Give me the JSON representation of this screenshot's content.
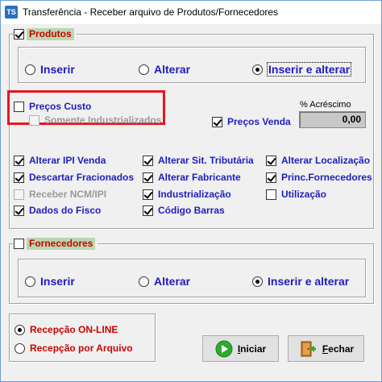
{
  "window": {
    "title": "Transferência - Receber arquivo de Produtos/Fornecedores",
    "icon": "ts-app-icon",
    "icon_text": "TS"
  },
  "produtos": {
    "legend": "Produtos",
    "checked": true,
    "options": [
      {
        "label": "Inserir",
        "selected": false
      },
      {
        "label": "Alterar",
        "selected": false
      },
      {
        "label": "Inserir e alterar",
        "selected": true
      }
    ],
    "precos_custo": {
      "label": "Preços Custo",
      "checked": false
    },
    "somente_industrializados": {
      "label": "Somente Industrializados",
      "checked": false,
      "disabled": true
    },
    "acrescimo_label": "% Acréscimo",
    "precos_venda": {
      "label": "Preços Venda",
      "checked": true
    },
    "acrescimo_value": "0,00",
    "flags": [
      {
        "label": "Alterar IPI Venda",
        "checked": true,
        "disabled": false
      },
      {
        "label": "Alterar Sit. Tributária",
        "checked": true,
        "disabled": false
      },
      {
        "label": "Alterar Localização",
        "checked": true,
        "disabled": false
      },
      {
        "label": "Descartar Fracionados",
        "checked": true,
        "disabled": false
      },
      {
        "label": "Alterar Fabricante",
        "checked": true,
        "disabled": false
      },
      {
        "label": "Princ.Fornecedores",
        "checked": true,
        "disabled": false
      },
      {
        "label": "Receber NCM/IPI",
        "checked": false,
        "disabled": true
      },
      {
        "label": "Industrialização",
        "checked": true,
        "disabled": false
      },
      {
        "label": "Utilização",
        "checked": false,
        "disabled": false
      },
      {
        "label": "Dados do Fisco",
        "checked": true,
        "disabled": false
      },
      {
        "label": "Código Barras",
        "checked": true,
        "disabled": false
      }
    ]
  },
  "fornecedores": {
    "legend": "Fornecedores",
    "checked": false,
    "options": [
      {
        "label": "Inserir",
        "selected": false
      },
      {
        "label": "Alterar",
        "selected": false
      },
      {
        "label": "Inserir e alterar",
        "selected": true
      }
    ]
  },
  "recepcao": {
    "online": {
      "label": "Recepção ON-LINE",
      "selected": true
    },
    "arquivo": {
      "label": "Recepção por Arquivo",
      "selected": false
    }
  },
  "buttons": {
    "iniciar": {
      "accel": "I",
      "rest": "niciar"
    },
    "fechar": {
      "accel": "F",
      "rest": "echar"
    }
  },
  "colors": {
    "highlight": "#e8151f",
    "label_blue": "#1e1ebe",
    "label_red": "#cc0000",
    "legend_bg": "#b9d8b0"
  }
}
